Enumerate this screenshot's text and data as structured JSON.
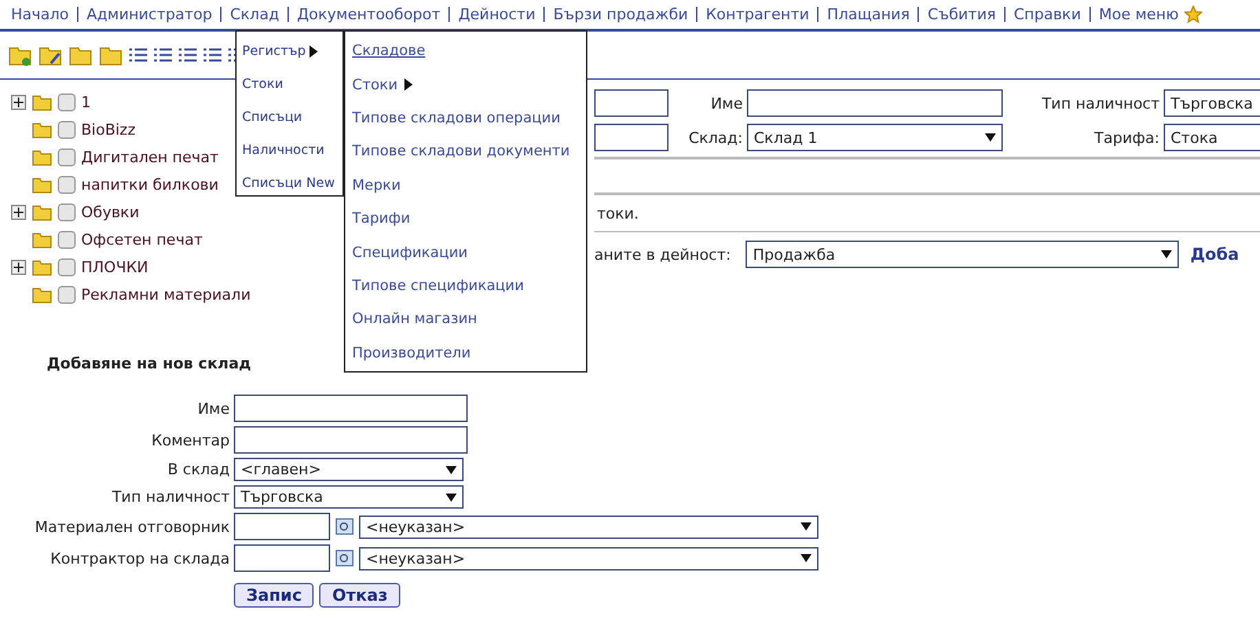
{
  "nav": {
    "items": [
      "Начало",
      "Администратор",
      "Склад",
      "Документооборот",
      "Дейности",
      "Бързи продажби",
      "Контрагенти",
      "Плащания",
      "Събития",
      "Справки",
      "Мое меню"
    ]
  },
  "tree": [
    {
      "label": "1",
      "kind": "branch",
      "checked": false
    },
    {
      "label": "BioBizz",
      "kind": "leaf",
      "checked": false
    },
    {
      "label": "Дигитален печат",
      "kind": "leaf",
      "checked": false
    },
    {
      "label": "напитки билкови",
      "kind": "leaf",
      "checked": false
    },
    {
      "label": "Обувки",
      "kind": "branch",
      "checked": false
    },
    {
      "label": "Офсетен печат",
      "kind": "leaf",
      "checked": false
    },
    {
      "label": "ПЛОЧКИ",
      "kind": "branch",
      "checked": false
    },
    {
      "label": "Рекламни материали",
      "kind": "leaf",
      "checked": false
    }
  ],
  "filters": {
    "name_label": "Име",
    "stock_type_label": "Тип наличност",
    "stock_type_value": "Търговска",
    "warehouse_label": "Склад:",
    "warehouse_value": "Склад 1",
    "tariff_label": "Тарифа:",
    "tariff_value": "Стока"
  },
  "note": "токи.",
  "activity": {
    "label": "аните в дейност:",
    "value": "Продажба",
    "link": "Доба"
  },
  "menu": {
    "items": [
      {
        "label": "Регистър",
        "submenu": true
      },
      {
        "label": "Стоки",
        "submenu": false
      },
      {
        "label": "Списъци",
        "submenu": false
      },
      {
        "label": "Наличности",
        "submenu": false
      },
      {
        "label": "Списъци New",
        "submenu": false
      }
    ],
    "subitems": [
      {
        "label": "Складове",
        "submenu": false,
        "selected": true
      },
      {
        "label": "Стоки",
        "submenu": true,
        "selected": false
      },
      {
        "label": "Типове складови операции",
        "submenu": false,
        "selected": false
      },
      {
        "label": "Типове складови документи",
        "submenu": false,
        "selected": false
      },
      {
        "label": "Мерки",
        "submenu": false,
        "selected": false
      },
      {
        "label": "Тарифи",
        "submenu": false,
        "selected": false
      },
      {
        "label": "Спецификации",
        "submenu": false,
        "selected": false
      },
      {
        "label": "Типове спецификации",
        "submenu": false,
        "selected": false
      },
      {
        "label": "Онлайн магазин",
        "submenu": false,
        "selected": false
      },
      {
        "label": "Производители",
        "submenu": false,
        "selected": false
      }
    ]
  },
  "form": {
    "title": "Добавяне на нов склад",
    "fields": [
      {
        "label": "Име",
        "kind": "text"
      },
      {
        "label": "Коментар",
        "kind": "text"
      },
      {
        "label": "В склад",
        "kind": "select",
        "value": "<главен>"
      },
      {
        "label": "Тип наличност",
        "kind": "select",
        "value": "Търговска"
      },
      {
        "label": "Материален отговорник",
        "kind": "lookup",
        "value": "<неуказан>"
      },
      {
        "label": "Контрактор на склада",
        "kind": "lookup",
        "value": "<неуказан>"
      }
    ],
    "buttons": [
      "Запис",
      "Отказ"
    ]
  }
}
